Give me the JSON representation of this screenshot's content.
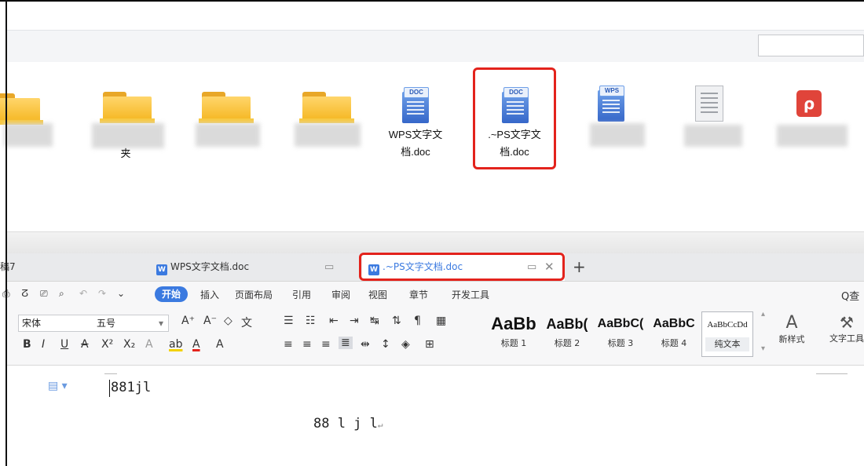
{
  "explorer": {
    "files": [
      {
        "type": "folder",
        "name": ""
      },
      {
        "type": "folder",
        "name": "夹"
      },
      {
        "type": "folder",
        "name": ""
      },
      {
        "type": "folder",
        "name": ""
      },
      {
        "type": "doc",
        "badge": "DOC",
        "name_line1": "WPS文字文",
        "name_line2": "档.doc"
      },
      {
        "type": "doc",
        "badge": "DOC",
        "name_line1": ".~PS文字文",
        "name_line2": "档.doc",
        "highlighted": true
      },
      {
        "type": "wps",
        "badge": "WPS",
        "name": ""
      },
      {
        "type": "txt",
        "name": ""
      },
      {
        "type": "pdf",
        "name": ""
      }
    ]
  },
  "wps": {
    "tabs": [
      {
        "label": "稿7"
      },
      {
        "label": "WPS文字文档.doc"
      },
      {
        "label": ".~PS文字文档.doc",
        "active": true
      }
    ],
    "new_tab": "+",
    "tab_icon_letter": "W",
    "menu": {
      "start": "开始",
      "items": [
        "插入",
        "页面布局",
        "引用",
        "审阅",
        "视图",
        "章节",
        "开发工具"
      ],
      "search": "Q查"
    },
    "ribbon": {
      "font_name": "宋体",
      "font_size": "五号",
      "styles": [
        {
          "sample": "AaBb",
          "label": "标题 1"
        },
        {
          "sample": "AaBb(",
          "label": "标题 2"
        },
        {
          "sample": "AaBbC(",
          "label": "标题 3"
        },
        {
          "sample": "AaBbC",
          "label": "标题 4"
        },
        {
          "sample": "AaBbCcDd",
          "label": "纯文本"
        }
      ],
      "new_style": "新样式",
      "text_tools": "文字工具"
    },
    "document": {
      "line1": "881jl",
      "line2": "88  l  j  l"
    }
  },
  "colors": {
    "accent": "#3b7ae0",
    "highlight": "#e3231c",
    "folder": "#f4b41a"
  }
}
